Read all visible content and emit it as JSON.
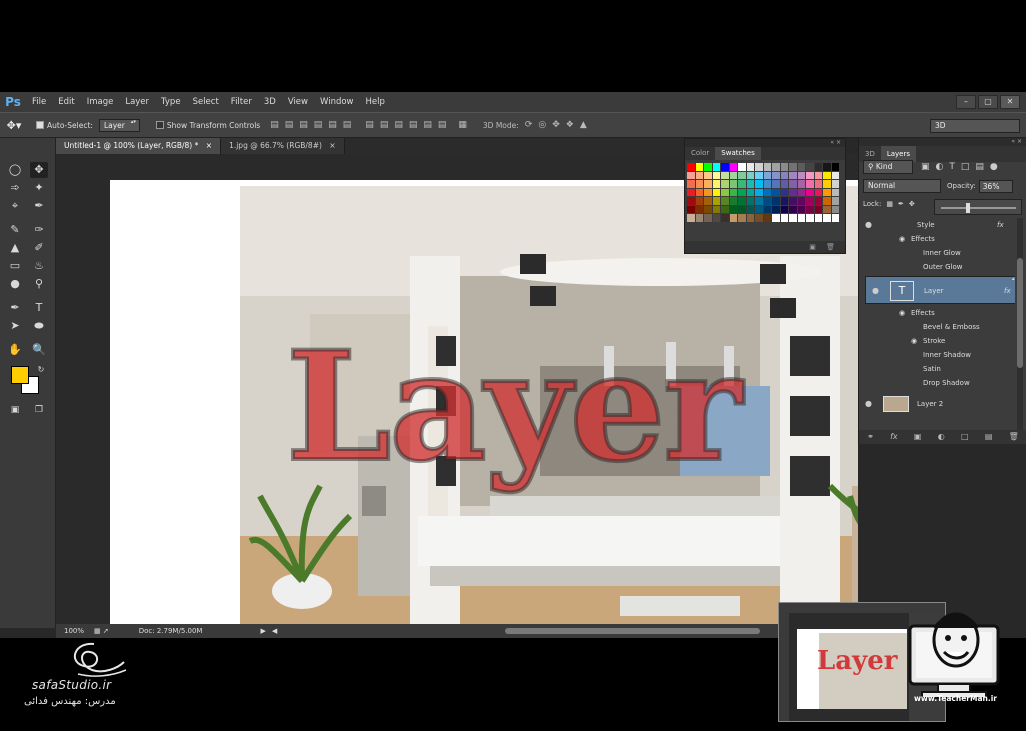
{
  "app": {
    "logo": "Ps",
    "menu": [
      "File",
      "Edit",
      "Image",
      "Layer",
      "Type",
      "Select",
      "Filter",
      "3D",
      "View",
      "Window",
      "Help"
    ],
    "window_buttons": [
      "–",
      "▢",
      "✕"
    ]
  },
  "options_bar": {
    "auto_select_label": "Auto-Select:",
    "auto_select_target": "Layer",
    "show_transform_label": "Show Transform Controls",
    "mode_3d_label": "3D Mode:",
    "workspace": "3D"
  },
  "tabs": [
    {
      "label": "Untitled-1 @ 100% (Layer, RGB/8) *",
      "close": "×"
    },
    {
      "label": "1.jpg @ 66.7% (RGB/8#)",
      "close": "×"
    }
  ],
  "canvas": {
    "text": "Layer"
  },
  "status_bar": {
    "zoom": "100%",
    "doc": "Doc: 2.79M/5.00M"
  },
  "swatches_panel": {
    "tabs": [
      "Color",
      "Swatches"
    ],
    "active_tab": "Swatches",
    "colors": [
      [
        "#ff0000",
        "#ffff00",
        "#00ff00",
        "#00ffff",
        "#0000ff",
        "#ff00ff",
        "#ffffff",
        "#e8e8e8",
        "#d1d1d1",
        "#b9b9b9",
        "#a2a2a2",
        "#8b8b8b",
        "#737373",
        "#5c5c5c",
        "#454545",
        "#2d2d2d",
        "#161616",
        "#000000"
      ],
      [
        "#f6a09a",
        "#f9ad81",
        "#fdc68a",
        "#fff79a",
        "#c4df9b",
        "#a3d39c",
        "#82ca9c",
        "#7bcdc8",
        "#6ecff6",
        "#7ea7d8",
        "#8493ca",
        "#8882be",
        "#a187be",
        "#bc8cbf",
        "#f49ac2",
        "#f6989d",
        "#ffe600",
        "#e8e8e8"
      ],
      [
        "#f26c4f",
        "#f68e55",
        "#fbaf5c",
        "#fff467",
        "#acd372",
        "#7cc576",
        "#3bb878",
        "#1abbb4",
        "#00bff3",
        "#438ccb",
        "#5574b9",
        "#605ca8",
        "#855fa8",
        "#a763a8",
        "#f06ea9",
        "#f26d7d",
        "#ffcc00",
        "#d1d1d1"
      ],
      [
        "#ed1c24",
        "#f26522",
        "#f7941d",
        "#fff200",
        "#8dc63f",
        "#39b54a",
        "#00a651",
        "#00a99d",
        "#00aeef",
        "#0072bc",
        "#0054a6",
        "#2e3192",
        "#662d91",
        "#92278f",
        "#ec008c",
        "#ed145b",
        "#ff9900",
        "#b9b9b9"
      ],
      [
        "#9e0b0f",
        "#a0410d",
        "#a36209",
        "#aba000",
        "#598527",
        "#197b30",
        "#007236",
        "#00746b",
        "#0076a3",
        "#004b80",
        "#003471",
        "#1b1464",
        "#440e62",
        "#630460",
        "#9e005d",
        "#9e0039",
        "#cc6600",
        "#a2a2a2"
      ],
      [
        "#790000",
        "#7b2e00",
        "#7d4900",
        "#827b00",
        "#406618",
        "#005e20",
        "#005826",
        "#005952",
        "#005b7f",
        "#003663",
        "#002157",
        "#0d004c",
        "#32004b",
        "#4b0049",
        "#7b0046",
        "#7a0026",
        "#996633",
        "#8b8b8b"
      ],
      [
        "#c7b299",
        "#998675",
        "#736357",
        "#534741",
        "#37302d",
        "#c69c6e",
        "#a67c52",
        "#8c6239",
        "#754c24",
        "#603913",
        "#ffffff",
        "#ffffff",
        "#ffffff",
        "#ffffff",
        "#ffffff",
        "#ffffff",
        "#ffffff",
        "#ffffff"
      ]
    ]
  },
  "layers_panel": {
    "tabs": [
      "3D",
      "Layers"
    ],
    "active_tab": "Layers",
    "kind_label": "Kind",
    "blend_mode": "Normal",
    "opacity_label": "Opacity:",
    "opacity_value": "36%",
    "opacity_slider_level": 0.36,
    "lock_label": "Lock:",
    "rows": [
      {
        "label": "Style",
        "type": "style",
        "fx": "fx"
      },
      {
        "label": "Effects",
        "type": "effects"
      },
      {
        "label": "Inner Glow",
        "type": "effect"
      },
      {
        "label": "Outer Glow",
        "type": "effect"
      },
      {
        "label": "Layer",
        "type": "layer-text",
        "fx": "fx",
        "selected": true
      },
      {
        "label": "Effects",
        "type": "effects"
      },
      {
        "label": "Bevel & Emboss",
        "type": "effect"
      },
      {
        "label": "Stroke",
        "type": "effect-eye"
      },
      {
        "label": "Inner Shadow",
        "type": "effect"
      },
      {
        "label": "Satin",
        "type": "effect"
      },
      {
        "label": "Drop Shadow",
        "type": "effect"
      },
      {
        "label": "Layer 2",
        "type": "layer-image"
      }
    ]
  },
  "branding": {
    "site": "safaStudio.ir",
    "teacher": "مدرس: مهندس فدائی",
    "teacherman_url": "www.TeacherMan.ir"
  }
}
